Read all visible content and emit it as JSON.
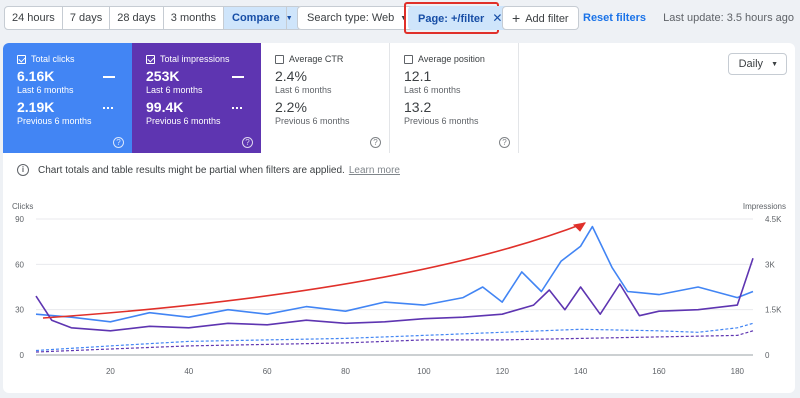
{
  "toolbar": {
    "ranges": [
      "24 hours",
      "7 days",
      "28 days",
      "3 months"
    ],
    "compare_label": "Compare",
    "search_type": "Search type: Web",
    "page_filter": "Page: +/filter",
    "add_filter": "Add filter",
    "reset_filters": "Reset filters",
    "last_update": "Last update: 3.5 hours ago"
  },
  "metrics": {
    "clicks": {
      "title": "Total clicks",
      "current": "6.16K",
      "current_label": "Last 6 months",
      "previous": "2.19K",
      "previous_label": "Previous 6 months"
    },
    "impressions": {
      "title": "Total impressions",
      "current": "253K",
      "current_label": "Last 6 months",
      "previous": "99.4K",
      "previous_label": "Previous 6 months"
    },
    "ctr": {
      "title": "Average CTR",
      "current": "2.4%",
      "current_label": "Last 6 months",
      "previous": "2.2%",
      "previous_label": "Previous 6 months"
    },
    "position": {
      "title": "Average position",
      "current": "12.1",
      "current_label": "Last 6 months",
      "previous": "13.2",
      "previous_label": "Previous 6 months"
    }
  },
  "granularity": "Daily",
  "notice": {
    "text": "Chart totals and table results might be partial when filters are applied.",
    "link": "Learn more"
  },
  "colors": {
    "clicks": "#4285f4",
    "impressions": "#5e35b1",
    "annotation": "#e0302a"
  },
  "chart_data": {
    "type": "line",
    "x_ticks": [
      20,
      40,
      60,
      80,
      100,
      120,
      140,
      160,
      180
    ],
    "xlim": [
      1,
      184
    ],
    "left_axis": {
      "label": "Clicks",
      "ticks": [
        "0",
        "30",
        "60",
        "90"
      ],
      "ylim": [
        0,
        90
      ]
    },
    "right_axis": {
      "label": "Impressions",
      "ticks": [
        "0",
        "1.5K",
        "3K",
        "4.5K"
      ],
      "ylim": [
        0,
        4500
      ]
    },
    "series": [
      {
        "axis": "left",
        "style": "solid",
        "color": "#4285f4",
        "points": [
          [
            1,
            27
          ],
          [
            10,
            25
          ],
          [
            20,
            22
          ],
          [
            30,
            28
          ],
          [
            40,
            25
          ],
          [
            50,
            30
          ],
          [
            60,
            27
          ],
          [
            70,
            32
          ],
          [
            80,
            29
          ],
          [
            90,
            35
          ],
          [
            100,
            33
          ],
          [
            110,
            38
          ],
          [
            115,
            45
          ],
          [
            120,
            35
          ],
          [
            125,
            55
          ],
          [
            130,
            42
          ],
          [
            135,
            62
          ],
          [
            140,
            72
          ],
          [
            143,
            85
          ],
          [
            148,
            58
          ],
          [
            152,
            42
          ],
          [
            160,
            40
          ],
          [
            170,
            45
          ],
          [
            180,
            38
          ],
          [
            184,
            42
          ]
        ]
      },
      {
        "axis": "right",
        "style": "solid",
        "color": "#5e35b1",
        "points": [
          [
            1,
            1950
          ],
          [
            5,
            1150
          ],
          [
            10,
            900
          ],
          [
            20,
            800
          ],
          [
            30,
            950
          ],
          [
            40,
            900
          ],
          [
            50,
            1050
          ],
          [
            60,
            1000
          ],
          [
            70,
            1150
          ],
          [
            80,
            1050
          ],
          [
            90,
            1100
          ],
          [
            100,
            1200
          ],
          [
            110,
            1250
          ],
          [
            120,
            1350
          ],
          [
            128,
            1650
          ],
          [
            132,
            2150
          ],
          [
            136,
            1500
          ],
          [
            140,
            2250
          ],
          [
            145,
            1350
          ],
          [
            150,
            2350
          ],
          [
            155,
            1300
          ],
          [
            160,
            1450
          ],
          [
            170,
            1500
          ],
          [
            180,
            1650
          ],
          [
            184,
            3200
          ]
        ]
      },
      {
        "axis": "left",
        "style": "dashed",
        "color": "#4285f4",
        "points": [
          [
            1,
            3
          ],
          [
            20,
            6
          ],
          [
            40,
            9
          ],
          [
            60,
            10
          ],
          [
            80,
            11
          ],
          [
            100,
            13
          ],
          [
            120,
            15
          ],
          [
            140,
            17
          ],
          [
            160,
            16
          ],
          [
            170,
            15
          ],
          [
            180,
            18
          ],
          [
            184,
            21
          ]
        ]
      },
      {
        "axis": "right",
        "style": "dashed",
        "color": "#5e35b1",
        "points": [
          [
            1,
            100
          ],
          [
            20,
            200
          ],
          [
            40,
            300
          ],
          [
            60,
            350
          ],
          [
            80,
            400
          ],
          [
            100,
            500
          ],
          [
            120,
            500
          ],
          [
            140,
            550
          ],
          [
            160,
            600
          ],
          [
            180,
            650
          ],
          [
            184,
            800
          ]
        ]
      }
    ]
  }
}
